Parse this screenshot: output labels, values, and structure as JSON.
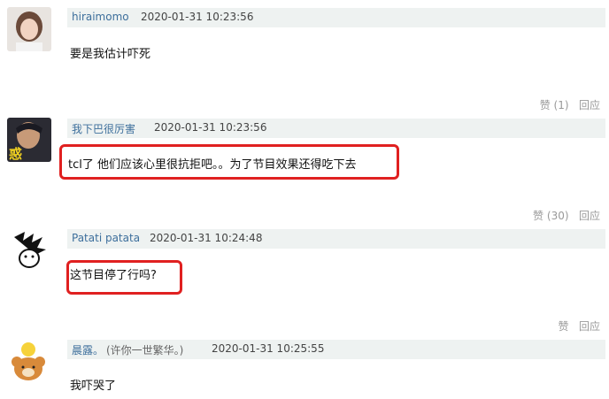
{
  "comments": [
    {
      "username": "hiraimomo",
      "timestamp": "2020-01-31 10:23:56",
      "text": "要是我估计吓死",
      "like_label": "赞",
      "like_count": "(1)",
      "reply_label": "回应"
    },
    {
      "username": "我下巴很厉害",
      "timestamp": "2020-01-31 10:23:56",
      "text": "tcl了 他们应该心里很抗拒吧。。为了节目效果还得吃下去",
      "avatar_text": "惑",
      "like_label": "赞",
      "like_count": "(30)",
      "reply_label": "回应"
    },
    {
      "username": "Patati patata",
      "timestamp": "2020-01-31 10:24:48",
      "text": "这节目停了行吗?",
      "like_label": "赞",
      "reply_label": "回应"
    },
    {
      "username": "晨露。",
      "user_note": "(许你一世繁华。)",
      "timestamp": "2020-01-31 10:25:55",
      "text": "我吓哭了"
    }
  ],
  "colors": {
    "highlight": "#e02020",
    "username": "#3d6f9c",
    "header_bg": "#eef2f1"
  }
}
